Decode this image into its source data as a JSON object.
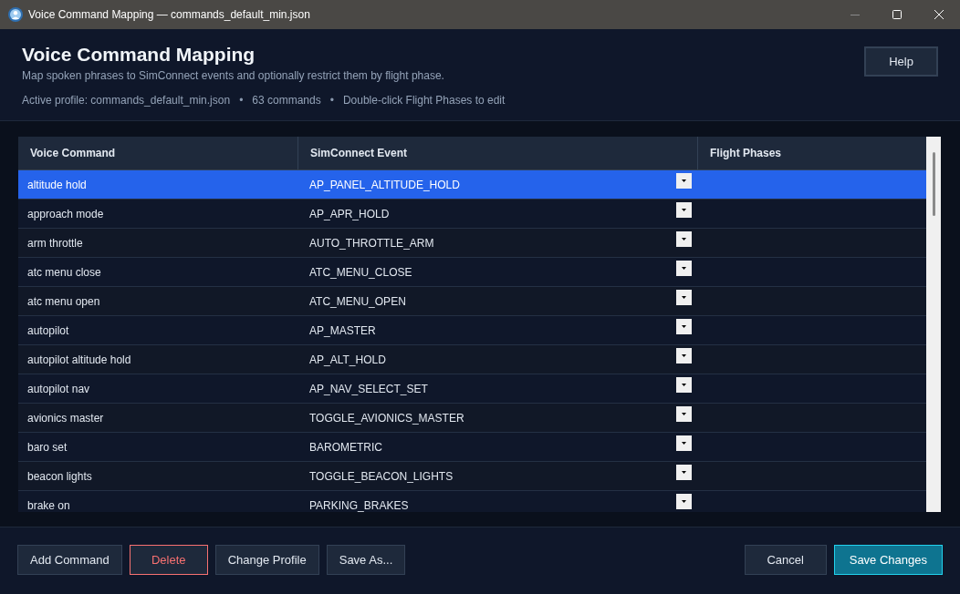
{
  "window": {
    "title": "Voice Command Mapping — commands_default_min.json"
  },
  "header": {
    "title": "Voice Command Mapping",
    "subtitle": "Map spoken phrases to SimConnect events and optionally restrict them by flight phase.",
    "info": [
      {
        "kind": "text",
        "text": "Active profile: commands_default_min.json"
      },
      {
        "kind": "separator",
        "text": "•"
      },
      {
        "kind": "text",
        "text": "63 commands"
      },
      {
        "kind": "separator",
        "text": "•"
      },
      {
        "kind": "text",
        "text": "Double-click Flight Phases to edit"
      }
    ],
    "help_button": {
      "label": "Help",
      "kind": "default"
    }
  },
  "table": {
    "columns": [
      "Voice Command",
      "SimConnect Event",
      "Flight Phases"
    ],
    "rows": [
      {
        "command": "altitude hold",
        "event": "AP_PANEL_ALTITUDE_HOLD",
        "selected": true
      },
      {
        "command": "approach mode",
        "event": "AP_APR_HOLD",
        "selected": false
      },
      {
        "command": "arm throttle",
        "event": "AUTO_THROTTLE_ARM",
        "selected": false
      },
      {
        "command": "atc menu close",
        "event": "ATC_MENU_CLOSE",
        "selected": false
      },
      {
        "command": "atc menu open",
        "event": "ATC_MENU_OPEN",
        "selected": false
      },
      {
        "command": "autopilot",
        "event": "AP_MASTER",
        "selected": false
      },
      {
        "command": "autopilot altitude hold",
        "event": "AP_ALT_HOLD",
        "selected": false
      },
      {
        "command": "autopilot nav",
        "event": "AP_NAV_SELECT_SET",
        "selected": false
      },
      {
        "command": "avionics master",
        "event": "TOGGLE_AVIONICS_MASTER",
        "selected": false
      },
      {
        "command": "baro set",
        "event": "BAROMETRIC",
        "selected": false
      },
      {
        "command": "beacon lights",
        "event": "TOGGLE_BEACON_LIGHTS",
        "selected": false
      },
      {
        "command": "brake on",
        "event": "PARKING_BRAKES",
        "selected": false
      }
    ]
  },
  "footer": {
    "left_buttons": [
      {
        "label": "Add Command",
        "kind": "default"
      },
      {
        "label": "Delete",
        "kind": "danger"
      },
      {
        "label": "Change Profile",
        "kind": "default"
      },
      {
        "label": "Save As...",
        "kind": "default"
      }
    ],
    "right_buttons": [
      {
        "label": "Cancel",
        "kind": "default"
      },
      {
        "label": "Save Changes",
        "kind": "primary"
      }
    ]
  }
}
